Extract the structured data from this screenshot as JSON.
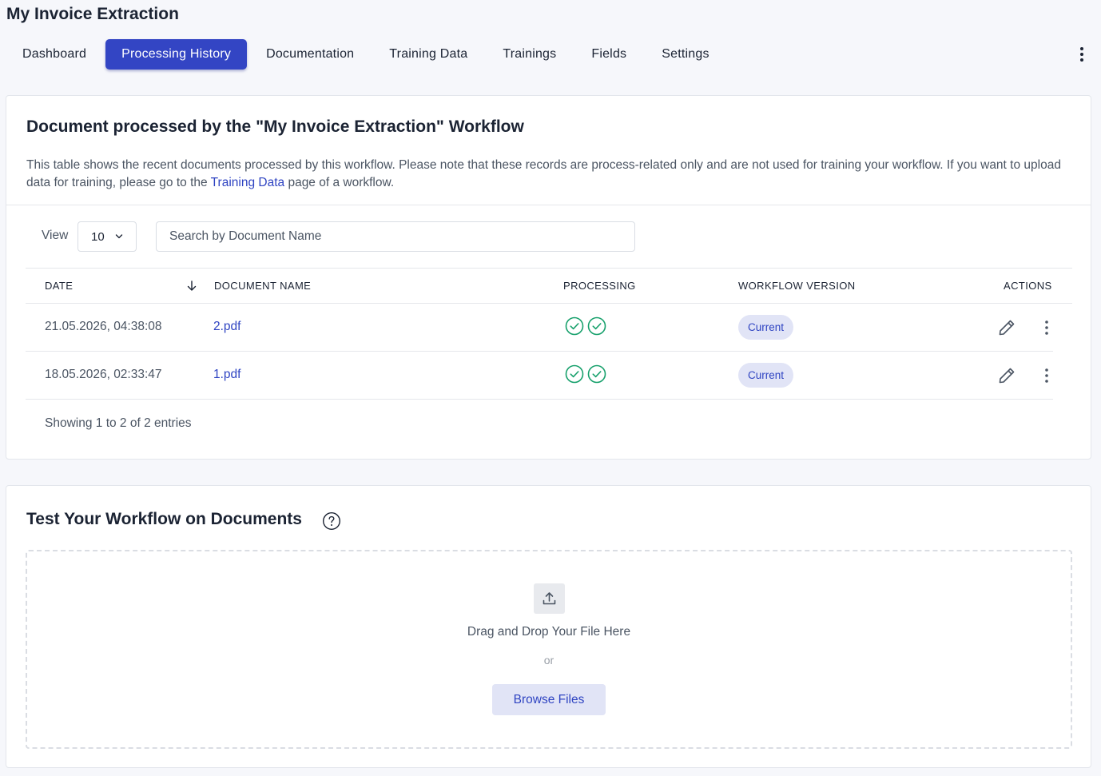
{
  "app": {
    "title": "My Invoice Extraction"
  },
  "nav": {
    "tabs": [
      {
        "label": "Dashboard",
        "active": false
      },
      {
        "label": "Processing History",
        "active": true
      },
      {
        "label": "Documentation",
        "active": false
      },
      {
        "label": "Training Data",
        "active": false
      },
      {
        "label": "Trainings",
        "active": false
      },
      {
        "label": "Fields",
        "active": false
      },
      {
        "label": "Settings",
        "active": false
      }
    ],
    "more_icon": "kebab-vertical-icon"
  },
  "history": {
    "title": "Document processed by the \"My Invoice Extraction\" Workflow",
    "description_part1": "This table shows the recent documents processed by this workflow. Please note that these records are process-related only and are not used for training your workflow. If you want to upload data for training, please go to the ",
    "description_link": "Training Data",
    "description_part2": " page of a workflow.",
    "view_label": "View",
    "view_value": "10",
    "search_placeholder": "Search by Document Name",
    "columns": {
      "date": "DATE",
      "document_name": "DOCUMENT NAME",
      "processing": "PROCESSING",
      "workflow_version": "WORKFLOW VERSION",
      "actions": "ACTIONS"
    },
    "rows": [
      {
        "date": "21.05.2026, 04:38:08",
        "document": "2.pdf",
        "processing": [
          "check-circle-icon",
          "check-circle-icon"
        ],
        "version": "Current"
      },
      {
        "date": "18.05.2026, 02:33:47",
        "document": "1.pdf",
        "processing": [
          "check-circle-icon",
          "check-circle-icon"
        ],
        "version": "Current"
      }
    ],
    "footer": "Showing 1 to 2 of 2 entries"
  },
  "test": {
    "title": "Test Your Workflow on Documents",
    "drop_text": "Drag and Drop Your File Here",
    "or_text": "or",
    "browse_label": "Browse Files"
  },
  "colors": {
    "accent": "#3345c4",
    "link": "#2f44c2",
    "success": "#16a06b",
    "badge_bg": "#e1e4f6"
  }
}
